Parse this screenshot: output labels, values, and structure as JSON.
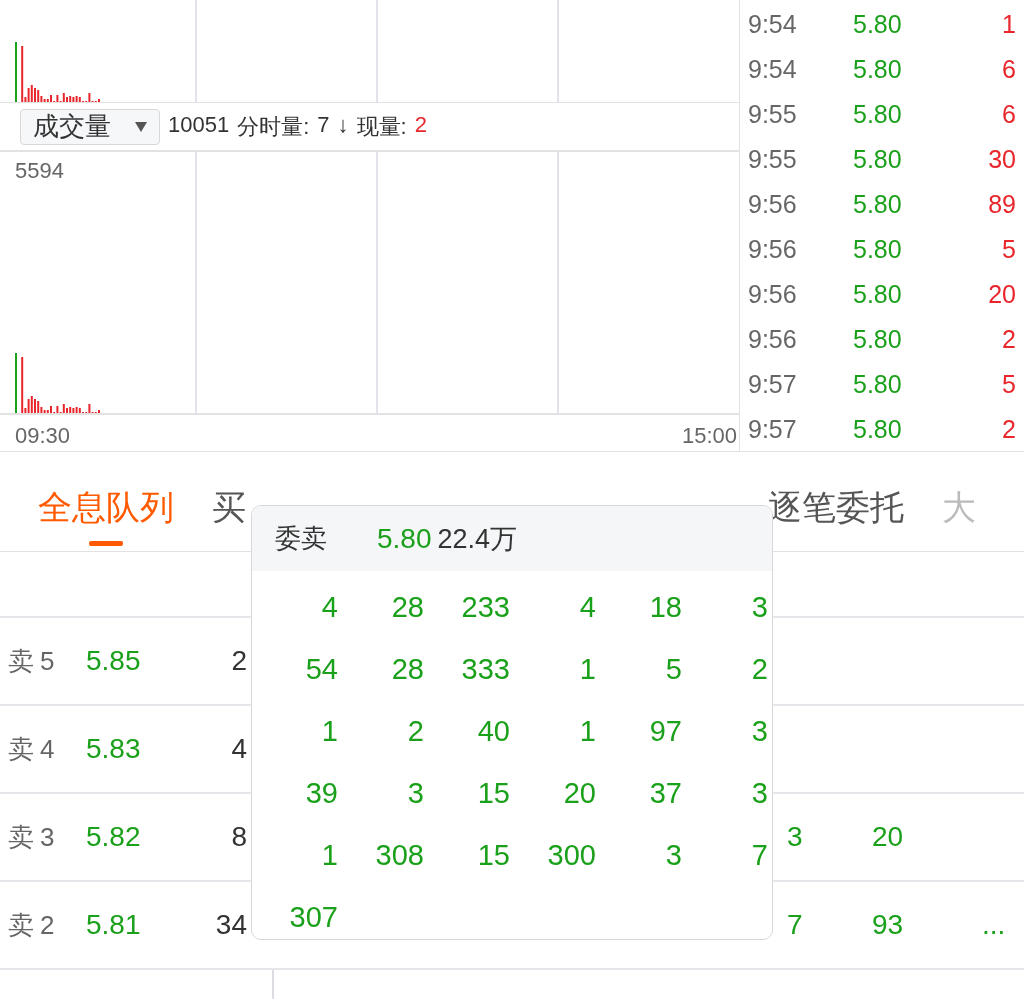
{
  "chart": {
    "indicator": "成交量",
    "total": "10051",
    "minute_label": "分时量:",
    "minute_value": "7",
    "arrow": "↓",
    "current_label": "现量:",
    "current_value": "2",
    "max_volume": "5594",
    "time_start": "09:30",
    "time_end": "15:00"
  },
  "trades": [
    {
      "time": "9:54",
      "price": "5.80",
      "volume": "1"
    },
    {
      "time": "9:54",
      "price": "5.80",
      "volume": "6"
    },
    {
      "time": "9:55",
      "price": "5.80",
      "volume": "6"
    },
    {
      "time": "9:55",
      "price": "5.80",
      "volume": "30"
    },
    {
      "time": "9:56",
      "price": "5.80",
      "volume": "89"
    },
    {
      "time": "9:56",
      "price": "5.80",
      "volume": "5"
    },
    {
      "time": "9:56",
      "price": "5.80",
      "volume": "20"
    },
    {
      "time": "9:56",
      "price": "5.80",
      "volume": "2"
    },
    {
      "time": "9:57",
      "price": "5.80",
      "volume": "5"
    },
    {
      "time": "9:57",
      "price": "5.80",
      "volume": "2"
    }
  ],
  "tabs": [
    {
      "label": "全息队列",
      "selected": true
    },
    {
      "label": "买",
      "selected": false
    },
    {
      "label": "逐笔委托",
      "selected": false
    },
    {
      "label": "大",
      "selected": false
    }
  ],
  "order_rows": [
    {
      "label": "卖5",
      "price": "5.85",
      "volume": "2",
      "queue": []
    },
    {
      "label": "卖4",
      "price": "5.83",
      "volume": "4",
      "queue": []
    },
    {
      "label": "卖3",
      "price": "5.82",
      "volume": "8",
      "queue": [
        "3",
        "20"
      ]
    },
    {
      "label": "卖2",
      "price": "5.81",
      "volume": "34",
      "queue": [
        "7",
        "93",
        "..."
      ]
    }
  ],
  "popup": {
    "title": "委卖",
    "price": "5.80",
    "amount": "22.4万",
    "orders": [
      "4",
      "28",
      "233",
      "4",
      "18",
      "3",
      "54",
      "28",
      "333",
      "1",
      "5",
      "2",
      "1",
      "2",
      "40",
      "1",
      "97",
      "3",
      "39",
      "3",
      "15",
      "20",
      "37",
      "3",
      "1",
      "308",
      "15",
      "300",
      "3",
      "7",
      "307"
    ]
  }
}
